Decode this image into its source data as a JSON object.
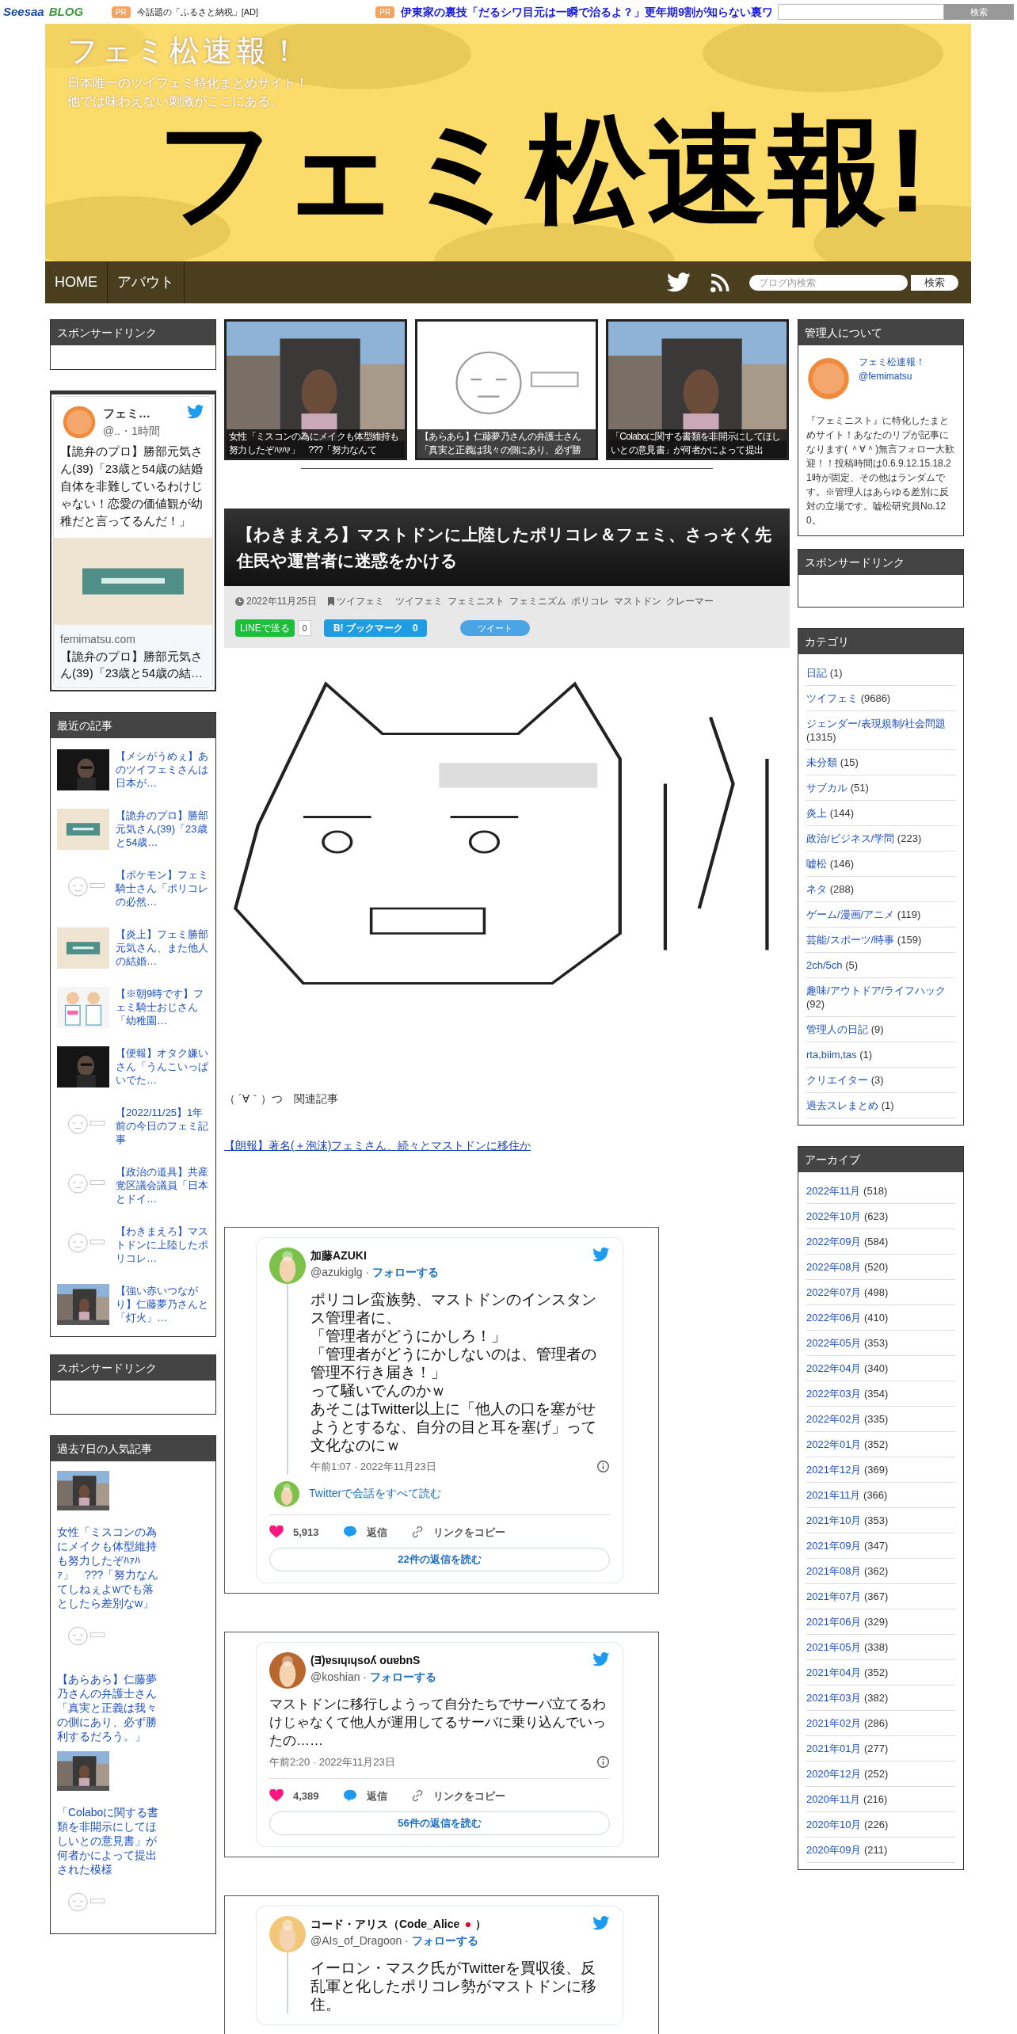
{
  "top_bar": {
    "logo": "Seesaa",
    "logo_sub": "BLOG",
    "ads": [
      {
        "badge": "PR",
        "text": "今話題の「ふるさと納税」[AD]",
        "kind": "plain"
      },
      {
        "badge": "PR",
        "text": "伊東家の裏技「だるシワ目元は一瞬で治るよ？」更年期9割が知らない裏ワ",
        "kind": "link"
      }
    ],
    "search_button": "検索"
  },
  "header": {
    "title": "フェミ松速報！",
    "tagline": [
      "日本唯一のツイフェミ特化まとめサイト！",
      "他では味わえない刺激がここにある。"
    ],
    "logo_text": "フェミ松速報!"
  },
  "nav": {
    "items": [
      "HOME",
      "アバウト"
    ],
    "search_placeholder": "ブログ内検索",
    "search_button": "検索"
  },
  "left_sidebar": {
    "sponsor_title": "スポンサードリンク",
    "twitter_widget": {
      "name": "フェミ…",
      "handle": "@..・1時間",
      "text": "【詭弁のプロ】勝部元気さん(39)「23歳と54歳の結婚自体を非難しているわけじゃない！恋愛の価値観が幼稚だと言ってるんだ！」",
      "card_domain": "femimatsu.com",
      "card_title": "【詭弁のプロ】勝部元気さん(39)「23歳と54歳の結…"
    },
    "recent": {
      "title": "最近の記事",
      "items": [
        {
          "title": "【メシがうめぇ】あのツイフェミさんは日本が…"
        },
        {
          "title": "【詭弁のプロ】勝部元気さん(39)「23歳と54歳…"
        },
        {
          "title": "【ポケモン】フェミ騎士さん「ポリコレの必然…"
        },
        {
          "title": "【炎上】フェミ勝部元気さん、また他人の結婚…"
        },
        {
          "title": "【※朝9時です】フェミ騎士おじさん「幼稚園…"
        },
        {
          "title": "【便報】オタク嫌いさん「うんこいっぱいでた…"
        },
        {
          "title": "【2022/11/25】1年前の今日のフェミ記事"
        },
        {
          "title": "【政治の道具】共産党区議会議員「日本とドイ…"
        },
        {
          "title": "【わきまえろ】マストドンに上陸したポリコレ…"
        },
        {
          "title": "【強い赤いつながり】仁藤夢乃さんと「灯火」…"
        }
      ]
    },
    "sponsor_title_2": "スポンサードリンク",
    "popular": {
      "title": "過去7日の人気記事",
      "items": [
        {
          "title": "女性「ミスコンの為にメイクも体型維持も努力したぞﾊｧﾊｧ」　???「努力なんてしねぇよwでも落としたら差別なw」"
        },
        {
          "title": "【あらあら】仁藤夢乃さんの弁護士さん「真実と正義は我々の側にあり、必ず勝利するだろう。」"
        },
        {
          "title": "「Colaboに関する書類を非開示にしてほしいとの意見書」が何者かによって提出された模様"
        }
      ]
    }
  },
  "featured": [
    {
      "caption": "女性「ミスコンの為にメイクも体型維持も努力したぞﾊｧﾊｧ」　???「努力なんて"
    },
    {
      "caption": "【あらあら】仁藤夢乃さんの弁護士さん「真実と正義は我々の側にあり、必ず勝"
    },
    {
      "caption": "「Colaboに関する書類を非開示にしてほしいとの意見書」が何者かによって提出"
    }
  ],
  "article": {
    "title": "【わきまえろ】マストドンに上陸したポリコレ＆フェミ、さっそく先住民や運営者に迷惑をかける",
    "date": "2022年11月25日",
    "category": "ツイフェミ",
    "tags": [
      "ツイフェミ",
      "フェミニスト",
      "フェミニズム",
      "ポリコレ",
      "マストドン",
      "クレーマー"
    ],
    "share": {
      "line": "LINEで送る",
      "line_count": "0",
      "hatena": "B! ブックマーク",
      "hatena_count": "0",
      "tweet": "ツイート"
    },
    "related_label": "（ ´∀｀）つ　関連記事",
    "related_link": "【朗報】著名(＋泡沫)フェミさん、続々とマストドンに移住か",
    "tweets": [
      {
        "kind": "thread",
        "name": "加藤AZUKI",
        "handle": "@azukiglg ·",
        "follow": "フォローする",
        "text": [
          "ポリコレ蛮族勢、マストドンのインスタンス管理者に、",
          "「管理者がどうにかしろ！」",
          "「管理者がどうにかしないのは、管理者の管理不行き届き！」",
          "って騒いでんのかｗ",
          "あそこはTwitter以上に「他人の口を塞がせようとするな、自分の目と耳を塞げ」って文化なのにｗ"
        ],
        "time": "午前1:07 · 2022年11月23日",
        "thread_link": "Twitterで会話をすべて読む",
        "likes": "5,913",
        "reply": "返信",
        "copy": "リンクをコピー",
        "more": "22件の返信を読む"
      },
      {
        "kind": "single",
        "name": "(Ǝ)ɐsıɥıɥsoʎ ouɐbnS",
        "handle": "@koshian ·",
        "follow": "フォローする",
        "text": [
          "マストドンに移行しようって自分たちでサーバ立てるわけじゃなくて他人が運用してるサーバに乗り込んでいったの……"
        ],
        "time": "午前2:20 · 2022年11月23日",
        "likes": "4,389",
        "reply": "返信",
        "copy": "リンクをコピー",
        "more": "56件の返信を読む"
      },
      {
        "kind": "thread",
        "name": "コード・アリス（Code_Alice",
        "name_flag": true,
        "name_end": "）",
        "handle": "@AIs_of_Dragoon ·",
        "follow": "フォローする",
        "text": [
          "イーロン・マスク氏がTwitterを買収後、反乱軍と化したポリコレ勢がマストドンに移住。"
        ]
      }
    ]
  },
  "right_sidebar": {
    "about": {
      "title": "管理人について",
      "name": "フェミ松速報！",
      "handle": "@femimatsu",
      "text": "『フェミニスト』に特化したまとめサイト！あなたのリプが記事になります( ＾∀＾)無言フォロー大歓迎！！投稿時間は0.6.9.12.15.18.21時が固定、その他はランダムです。※管理人はあらゆる差別に反対の立場です。嘘松研究員No.120。"
    },
    "sponsor_title": "スポンサードリンク",
    "categories": {
      "title": "カテゴリ",
      "items": [
        {
          "name": "日記",
          "count": "(1)"
        },
        {
          "name": "ツイフェミ",
          "count": "(9686)"
        },
        {
          "name": "ジェンダー/表現規制/社会問題",
          "count": "(1315)"
        },
        {
          "name": "未分類",
          "count": "(15)"
        },
        {
          "name": "サブカル",
          "count": "(51)"
        },
        {
          "name": "炎上",
          "count": "(144)"
        },
        {
          "name": "政治/ビジネス/学問",
          "count": "(223)"
        },
        {
          "name": "嘘松",
          "count": "(146)"
        },
        {
          "name": "ネタ",
          "count": "(288)"
        },
        {
          "name": "ゲーム/漫画/アニメ",
          "count": "(119)"
        },
        {
          "name": "芸能/スポーツ/時事",
          "count": "(159)"
        },
        {
          "name": "2ch/5ch",
          "count": "(5)"
        },
        {
          "name": "趣味/アウトドア/ライフハック",
          "count": "(92)"
        },
        {
          "name": "管理人の日記",
          "count": "(9)"
        },
        {
          "name": "rta,biim,tas",
          "count": "(1)"
        },
        {
          "name": "クリエイター",
          "count": "(3)"
        },
        {
          "name": "過去スレまとめ",
          "count": "(1)"
        }
      ]
    },
    "archive": {
      "title": "アーカイブ",
      "items": [
        {
          "name": "2022年11月",
          "count": "(518)"
        },
        {
          "name": "2022年10月",
          "count": "(623)"
        },
        {
          "name": "2022年09月",
          "count": "(584)"
        },
        {
          "name": "2022年08月",
          "count": "(520)"
        },
        {
          "name": "2022年07月",
          "count": "(498)"
        },
        {
          "name": "2022年06月",
          "count": "(410)"
        },
        {
          "name": "2022年05月",
          "count": "(353)"
        },
        {
          "name": "2022年04月",
          "count": "(340)"
        },
        {
          "name": "2022年03月",
          "count": "(354)"
        },
        {
          "name": "2022年02月",
          "count": "(335)"
        },
        {
          "name": "2022年01月",
          "count": "(352)"
        },
        {
          "name": "2021年12月",
          "count": "(369)"
        },
        {
          "name": "2021年11月",
          "count": "(366)"
        },
        {
          "name": "2021年10月",
          "count": "(353)"
        },
        {
          "name": "2021年09月",
          "count": "(347)"
        },
        {
          "name": "2021年08月",
          "count": "(362)"
        },
        {
          "name": "2021年07月",
          "count": "(367)"
        },
        {
          "name": "2021年06月",
          "count": "(329)"
        },
        {
          "name": "2021年05月",
          "count": "(338)"
        },
        {
          "name": "2021年04月",
          "count": "(352)"
        },
        {
          "name": "2021年03月",
          "count": "(382)"
        },
        {
          "name": "2021年02月",
          "count": "(286)"
        },
        {
          "name": "2021年01月",
          "count": "(277)"
        },
        {
          "name": "2020年12月",
          "count": "(252)"
        },
        {
          "name": "2020年11月",
          "count": "(216)"
        },
        {
          "name": "2020年10月",
          "count": "(226)"
        },
        {
          "name": "2020年09月",
          "count": "(211)"
        }
      ]
    }
  }
}
